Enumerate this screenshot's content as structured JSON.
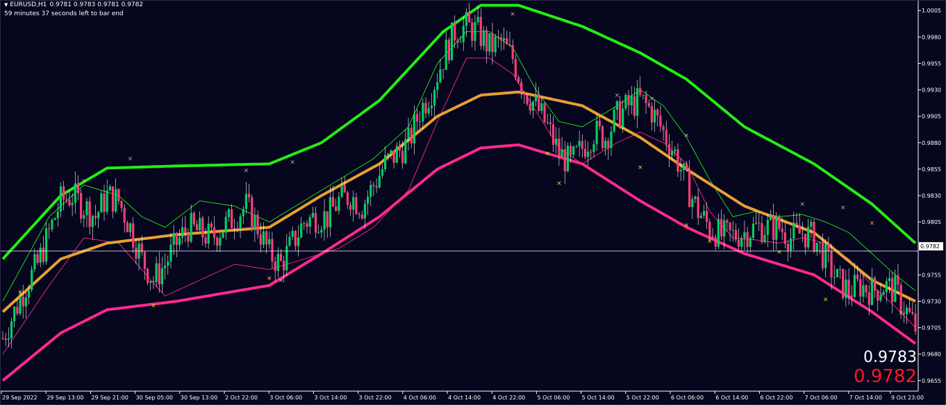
{
  "header": {
    "symbol": "EURUSD,H1",
    "ohlc": "0.9781 0.9783 0.9781 0.9782",
    "timer": "59 minutes 37 seconds left to bar end"
  },
  "quotes": {
    "ask": "0.9783",
    "bid": "0.9782",
    "bid_color": "#ff1a1a"
  },
  "colors": {
    "background": "#06061f",
    "axis": "#ffffff",
    "bull_candle": "#00d060",
    "bear_candle": "#ff3c78",
    "upper_band": "#22ee11",
    "middle_line": "#e8a030",
    "lower_band": "#ff2a8c",
    "thin_upper": "#22ee11",
    "thin_lower": "#ff2a8c",
    "buy_marker": "#cfe63a",
    "sell_marker": "#ff8fb4"
  },
  "chart_data": {
    "type": "candlestick",
    "symbol": "EURUSD",
    "timeframe": "H1",
    "current_price": 0.9782,
    "ylim": [
      0.9645,
      1.0015
    ],
    "y_ticks": [
      "1.0005",
      "0.9980",
      "0.9955",
      "0.9930",
      "0.9905",
      "0.9880",
      "0.9855",
      "0.9830",
      "0.9805",
      "0.9782",
      "0.9755",
      "0.9730",
      "0.9705",
      "0.9680",
      "0.9655"
    ],
    "x_ticks": [
      "29 Sep 2022",
      "29 Sep 13:00",
      "29 Sep 21:00",
      "30 Sep 05:00",
      "30 Sep 13:00",
      "2 Oct 22:00",
      "3 Oct 06:00",
      "3 Oct 14:00",
      "3 Oct 22:00",
      "4 Oct 06:00",
      "4 Oct 14:00",
      "4 Oct 22:00",
      "5 Oct 06:00",
      "5 Oct 14:00",
      "5 Oct 22:00",
      "6 Oct 06:00",
      "6 Oct 14:00",
      "6 Oct 22:00",
      "7 Oct 06:00",
      "7 Oct 14:00",
      "9 Oct 23:00"
    ],
    "close_path": [
      [
        0,
        0.9695
      ],
      [
        4,
        0.972
      ],
      [
        8,
        0.9745
      ],
      [
        12,
        0.9765
      ],
      [
        16,
        0.9795
      ],
      [
        20,
        0.9825
      ],
      [
        24,
        0.983
      ],
      [
        28,
        0.982
      ],
      [
        32,
        0.981
      ],
      [
        36,
        0.983
      ],
      [
        40,
        0.9825
      ],
      [
        44,
        0.98
      ],
      [
        48,
        0.977
      ],
      [
        52,
        0.975
      ],
      [
        56,
        0.9765
      ],
      [
        60,
        0.9785
      ],
      [
        64,
        0.98
      ],
      [
        68,
        0.9795
      ],
      [
        72,
        0.979
      ],
      [
        76,
        0.98
      ],
      [
        80,
        0.981
      ],
      [
        84,
        0.982
      ],
      [
        88,
        0.98
      ],
      [
        92,
        0.9775
      ],
      [
        96,
        0.9765
      ],
      [
        100,
        0.9785
      ],
      [
        104,
        0.9805
      ],
      [
        108,
        0.981
      ],
      [
        112,
        0.981
      ],
      [
        116,
        0.9825
      ],
      [
        120,
        0.983
      ],
      [
        124,
        0.982
      ],
      [
        128,
        0.984
      ],
      [
        132,
        0.986
      ],
      [
        136,
        0.987
      ],
      [
        140,
        0.988
      ],
      [
        144,
        0.991
      ],
      [
        148,
        0.993
      ],
      [
        152,
        0.996
      ],
      [
        156,
        0.9985
      ],
      [
        160,
        0.999
      ],
      [
        164,
        0.9985
      ],
      [
        168,
        0.997
      ],
      [
        172,
        0.9975
      ],
      [
        176,
        0.996
      ],
      [
        180,
        0.993
      ],
      [
        184,
        0.9915
      ],
      [
        188,
        0.9895
      ],
      [
        192,
        0.987
      ],
      [
        196,
        0.986
      ],
      [
        200,
        0.9875
      ],
      [
        204,
        0.989
      ],
      [
        208,
        0.9885
      ],
      [
        212,
        0.9905
      ],
      [
        216,
        0.9915
      ],
      [
        220,
        0.992
      ],
      [
        224,
        0.991
      ],
      [
        228,
        0.989
      ],
      [
        232,
        0.987
      ],
      [
        236,
        0.984
      ],
      [
        240,
        0.9815
      ],
      [
        244,
        0.98
      ],
      [
        248,
        0.9792
      ],
      [
        252,
        0.9792
      ],
      [
        256,
        0.9795
      ],
      [
        260,
        0.98
      ],
      [
        264,
        0.98
      ],
      [
        268,
        0.98
      ],
      [
        272,
        0.979
      ],
      [
        276,
        0.9795
      ],
      [
        280,
        0.979
      ],
      [
        284,
        0.977
      ],
      [
        288,
        0.975
      ],
      [
        292,
        0.974
      ],
      [
        296,
        0.9745
      ],
      [
        300,
        0.974
      ],
      [
        304,
        0.9745
      ],
      [
        308,
        0.974
      ],
      [
        312,
        0.972
      ],
      [
        315,
        0.9705
      ]
    ],
    "upper_band": [
      [
        0,
        0.977
      ],
      [
        20,
        0.983
      ],
      [
        36,
        0.9856
      ],
      [
        60,
        0.9858
      ],
      [
        92,
        0.986
      ],
      [
        110,
        0.988
      ],
      [
        130,
        0.992
      ],
      [
        152,
        0.9985
      ],
      [
        165,
        1.001
      ],
      [
        178,
        1.001
      ],
      [
        200,
        0.999
      ],
      [
        220,
        0.9965
      ],
      [
        236,
        0.994
      ],
      [
        256,
        0.9895
      ],
      [
        280,
        0.986
      ],
      [
        300,
        0.9822
      ],
      [
        315,
        0.9785
      ]
    ],
    "middle_line": [
      [
        0,
        0.972
      ],
      [
        20,
        0.977
      ],
      [
        36,
        0.9785
      ],
      [
        60,
        0.9793
      ],
      [
        92,
        0.98
      ],
      [
        110,
        0.983
      ],
      [
        130,
        0.986
      ],
      [
        150,
        0.9905
      ],
      [
        165,
        0.9925
      ],
      [
        178,
        0.9928
      ],
      [
        200,
        0.9915
      ],
      [
        220,
        0.9885
      ],
      [
        236,
        0.9855
      ],
      [
        256,
        0.982
      ],
      [
        280,
        0.9795
      ],
      [
        300,
        0.975
      ],
      [
        315,
        0.973
      ]
    ],
    "lower_band": [
      [
        0,
        0.9655
      ],
      [
        20,
        0.97
      ],
      [
        36,
        0.9722
      ],
      [
        60,
        0.973
      ],
      [
        92,
        0.9745
      ],
      [
        110,
        0.9775
      ],
      [
        130,
        0.981
      ],
      [
        150,
        0.9855
      ],
      [
        165,
        0.9875
      ],
      [
        178,
        0.9878
      ],
      [
        200,
        0.986
      ],
      [
        220,
        0.9825
      ],
      [
        236,
        0.98
      ],
      [
        256,
        0.9775
      ],
      [
        280,
        0.9755
      ],
      [
        300,
        0.972
      ],
      [
        315,
        0.969
      ]
    ],
    "thin_upper_band": [
      [
        0,
        0.973
      ],
      [
        16,
        0.981
      ],
      [
        28,
        0.984
      ],
      [
        40,
        0.983
      ],
      [
        48,
        0.981
      ],
      [
        56,
        0.98
      ],
      [
        68,
        0.9825
      ],
      [
        80,
        0.982
      ],
      [
        92,
        0.9805
      ],
      [
        104,
        0.9825
      ],
      [
        116,
        0.9845
      ],
      [
        128,
        0.9865
      ],
      [
        140,
        0.9895
      ],
      [
        150,
        0.9955
      ],
      [
        160,
        0.9985
      ],
      [
        168,
        0.9985
      ],
      [
        176,
        0.997
      ],
      [
        184,
        0.993
      ],
      [
        192,
        0.99
      ],
      [
        200,
        0.9895
      ],
      [
        212,
        0.9915
      ],
      [
        220,
        0.993
      ],
      [
        228,
        0.9915
      ],
      [
        236,
        0.9885
      ],
      [
        244,
        0.9845
      ],
      [
        252,
        0.981
      ],
      [
        260,
        0.9815
      ],
      [
        268,
        0.981
      ],
      [
        276,
        0.9812
      ],
      [
        284,
        0.9805
      ],
      [
        292,
        0.9795
      ],
      [
        300,
        0.9775
      ],
      [
        308,
        0.9755
      ],
      [
        315,
        0.974
      ]
    ],
    "thin_lower_band": [
      [
        0,
        0.968
      ],
      [
        16,
        0.9745
      ],
      [
        28,
        0.979
      ],
      [
        40,
        0.9785
      ],
      [
        48,
        0.976
      ],
      [
        56,
        0.9735
      ],
      [
        68,
        0.975
      ],
      [
        80,
        0.9765
      ],
      [
        92,
        0.976
      ],
      [
        104,
        0.977
      ],
      [
        116,
        0.978
      ],
      [
        128,
        0.98
      ],
      [
        140,
        0.9835
      ],
      [
        150,
        0.99
      ],
      [
        160,
        0.996
      ],
      [
        168,
        0.996
      ],
      [
        176,
        0.9945
      ],
      [
        184,
        0.991
      ],
      [
        192,
        0.9875
      ],
      [
        200,
        0.986
      ],
      [
        212,
        0.988
      ],
      [
        220,
        0.989
      ],
      [
        228,
        0.988
      ],
      [
        236,
        0.986
      ],
      [
        244,
        0.9815
      ],
      [
        252,
        0.979
      ],
      [
        260,
        0.9788
      ],
      [
        268,
        0.9785
      ],
      [
        276,
        0.979
      ],
      [
        284,
        0.9785
      ],
      [
        292,
        0.977
      ],
      [
        300,
        0.9745
      ],
      [
        308,
        0.9725
      ],
      [
        315,
        0.9705
      ]
    ],
    "sell_markers": [
      [
        28,
        0.9842
      ],
      [
        44,
        0.9863
      ],
      [
        84,
        0.9852
      ],
      [
        100,
        0.986
      ],
      [
        148,
        1.0015
      ],
      [
        154,
        1.0018
      ],
      [
        176,
        1.0
      ],
      [
        212,
        0.9923
      ],
      [
        224,
        0.992
      ],
      [
        236,
        0.9885
      ],
      [
        276,
        0.982
      ],
      [
        290,
        0.9817
      ],
      [
        300,
        0.9802
      ]
    ],
    "buy_markers": [
      [
        6,
        0.9737
      ],
      [
        52,
        0.9724
      ],
      [
        92,
        0.975
      ],
      [
        96,
        0.9748
      ],
      [
        188,
        0.9868
      ],
      [
        192,
        0.984
      ],
      [
        220,
        0.9855
      ],
      [
        236,
        0.98
      ],
      [
        244,
        0.9785
      ],
      [
        268,
        0.9775
      ],
      [
        284,
        0.973
      ],
      [
        310,
        0.9717
      ]
    ]
  }
}
